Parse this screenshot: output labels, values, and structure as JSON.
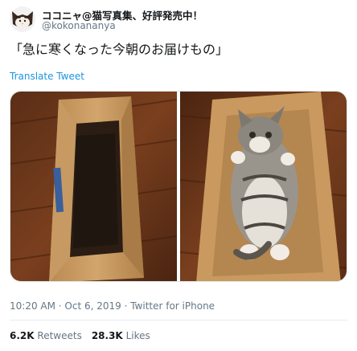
{
  "user": {
    "display_name": "ココニャ@猫写真集、好評発売中！",
    "handle": "@kokonananya",
    "avatar_icon": "cat-face-avatar"
  },
  "tweet": {
    "text": "「急に寒くなった今朝のお届けもの」",
    "translate_label": "Translate Tweet",
    "link_color": "#1b95e0"
  },
  "media": {
    "photo_count": 2,
    "left_icon": "empty-cardboard-box-photo",
    "right_icon": "cat-in-cardboard-box-photo"
  },
  "meta": {
    "timestamp": "10:20 AM · Oct 6, 2019 · Twitter for iPhone"
  },
  "stats": {
    "retweets_count": "6.2K",
    "retweets_label": "Retweets",
    "likes_count": "28.3K",
    "likes_label": "Likes"
  }
}
